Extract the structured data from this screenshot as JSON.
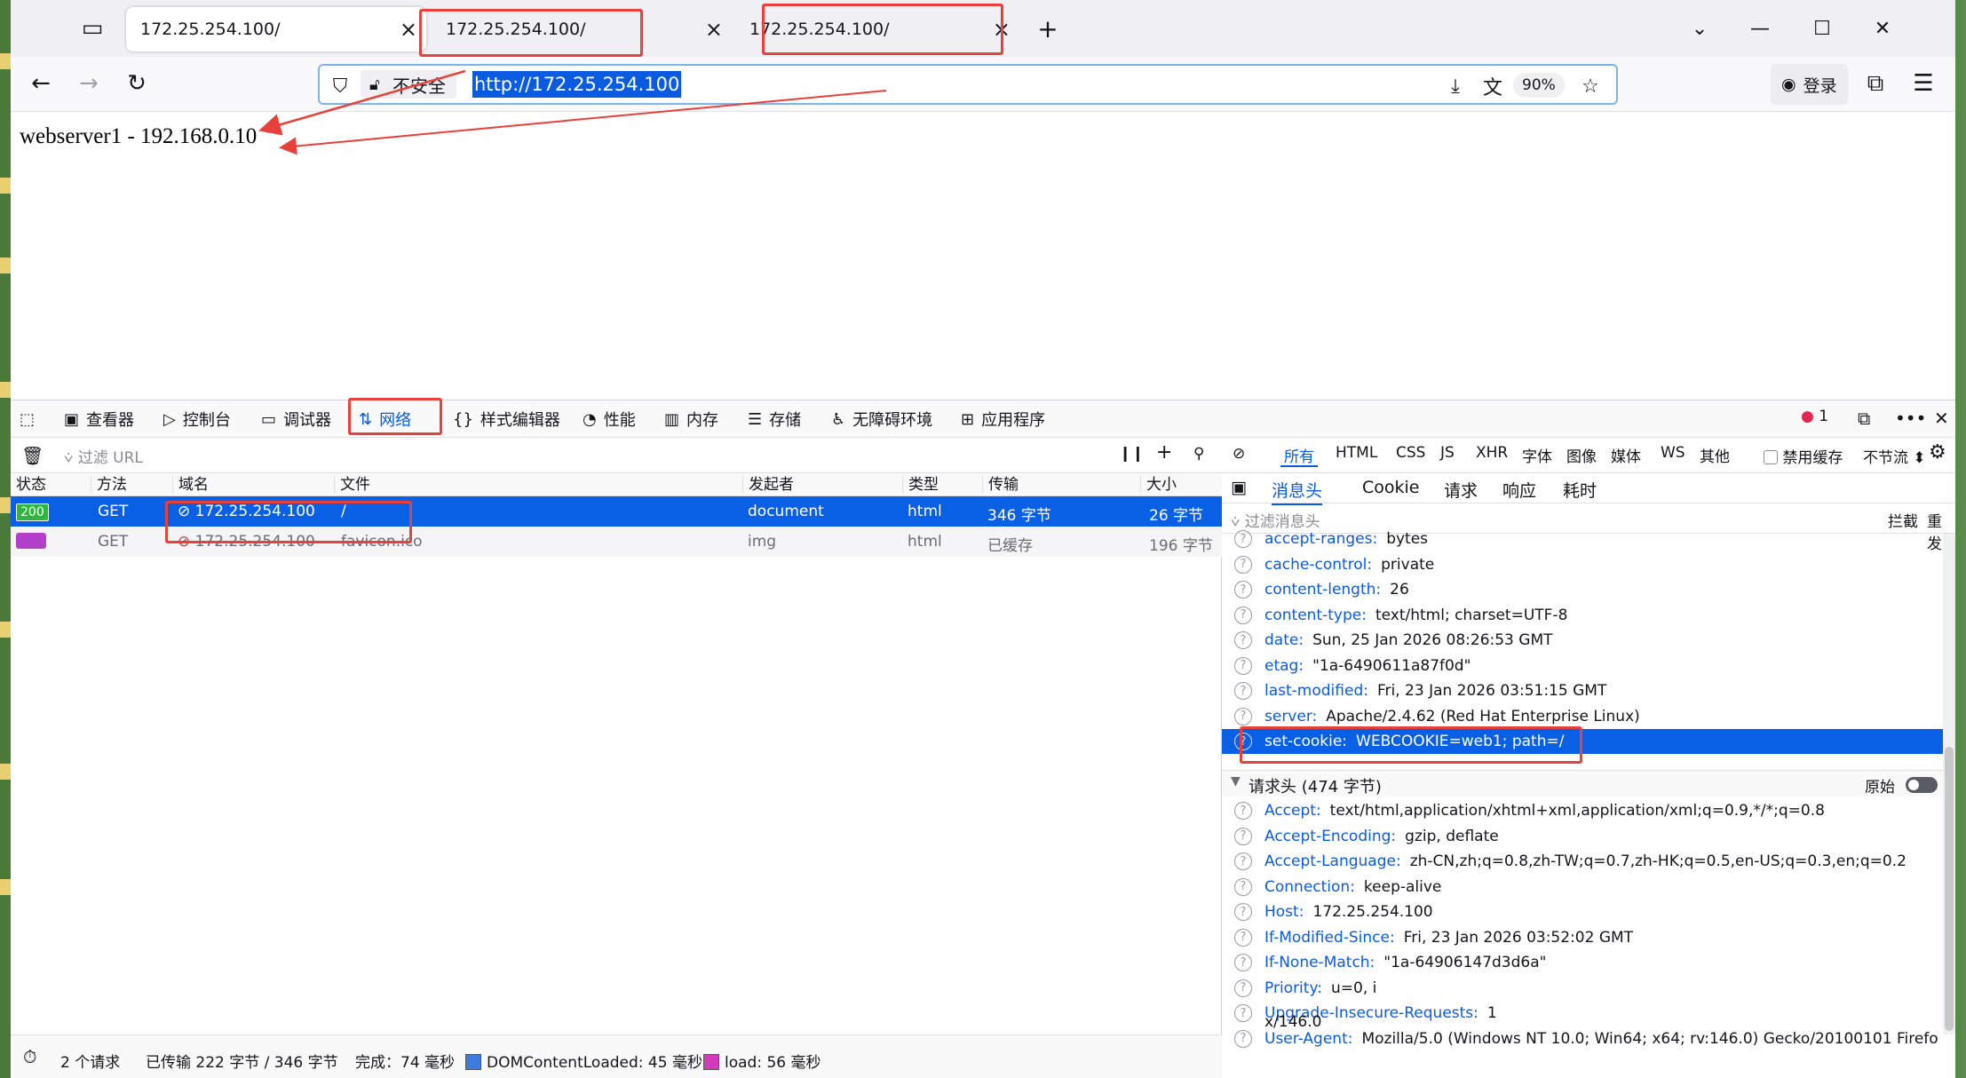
{
  "tabs": [
    {
      "title": "172.25.254.100/",
      "close": "×"
    },
    {
      "title": "172.25.254.100/",
      "close": "×"
    },
    {
      "title": "172.25.254.100/",
      "close": "×"
    }
  ],
  "tabstrip": {
    "new_tab": "+",
    "list_all": "⌄",
    "minimize": "—",
    "maximize": "☐",
    "close": "✕"
  },
  "navbar": {
    "back": "←",
    "forward": "→",
    "reload": "↻",
    "insecure_label": "不安全",
    "url": "http://172.25.254.100",
    "zoom": "90%",
    "login": "登录",
    "extensions": "⧉",
    "menu": "☰"
  },
  "page": {
    "text": "webserver1 - 192.168.0.10"
  },
  "devtools": {
    "tabs": [
      {
        "label": "查看器",
        "icon": "inspector-icon"
      },
      {
        "label": "控制台",
        "icon": "console-icon"
      },
      {
        "label": "调试器",
        "icon": "debugger-icon"
      },
      {
        "label": "网络",
        "icon": "network-icon"
      },
      {
        "label": "样式编辑器",
        "icon": "style-editor-icon"
      },
      {
        "label": "性能",
        "icon": "performance-icon"
      },
      {
        "label": "内存",
        "icon": "memory-icon"
      },
      {
        "label": "存储",
        "icon": "storage-icon"
      },
      {
        "label": "无障碍环境",
        "icon": "accessibility-icon"
      },
      {
        "label": "应用程序",
        "icon": "application-icon"
      }
    ],
    "error_count": "1",
    "filter_placeholder": "过滤 URL",
    "type_filters": [
      "所有",
      "HTML",
      "CSS",
      "JS",
      "XHR",
      "字体",
      "图像",
      "媒体",
      "WS",
      "其他"
    ],
    "disable_cache": "禁用缓存",
    "throttle": "不节流 ⬍",
    "columns": [
      "状态",
      "方法",
      "域名",
      "文件",
      "发起者",
      "类型",
      "传输",
      "大小"
    ],
    "requests": [
      {
        "status": "200",
        "method": "GET",
        "domain": "172.25.254.100",
        "file": "/",
        "initiator": "document",
        "type": "html",
        "transferred": "346 字节",
        "size": "26 字节"
      },
      {
        "status": "",
        "method": "GET",
        "domain": "172.25.254.100",
        "file": "favicon.ico",
        "initiator": "img",
        "type": "html",
        "transferred": "已缓存",
        "size": "196 字节"
      }
    ],
    "detail_tabs": [
      "消息头",
      "Cookie",
      "请求",
      "响应",
      "耗时"
    ],
    "detail_filter_placeholder": "过滤消息头",
    "detail_block": "拦截",
    "detail_resend": "重发",
    "response_headers": [
      {
        "key": "accept-ranges:",
        "value": "bytes"
      },
      {
        "key": "cache-control:",
        "value": "private"
      },
      {
        "key": "content-length:",
        "value": "26"
      },
      {
        "key": "content-type:",
        "value": "text/html; charset=UTF-8"
      },
      {
        "key": "date:",
        "value": "Sun, 25 Jan 2026 08:26:53 GMT"
      },
      {
        "key": "etag:",
        "value": "\"1a-6490611a87f0d\""
      },
      {
        "key": "last-modified:",
        "value": "Fri, 23 Jan 2026 03:51:15 GMT"
      },
      {
        "key": "server:",
        "value": "Apache/2.4.62 (Red Hat Enterprise Linux)"
      },
      {
        "key": "set-cookie:",
        "value": "WEBCOOKIE=web1; path=/"
      }
    ],
    "request_headers_title": "请求头 (474 字节)",
    "raw_label": "原始",
    "request_headers": [
      {
        "key": "Accept:",
        "value": "text/html,application/xhtml+xml,application/xml;q=0.9,*/*;q=0.8"
      },
      {
        "key": "Accept-Encoding:",
        "value": "gzip, deflate"
      },
      {
        "key": "Accept-Language:",
        "value": "zh-CN,zh;q=0.8,zh-TW;q=0.7,zh-HK;q=0.5,en-US;q=0.3,en;q=0.2"
      },
      {
        "key": "Connection:",
        "value": "keep-alive"
      },
      {
        "key": "Host:",
        "value": "172.25.254.100"
      },
      {
        "key": "If-Modified-Since:",
        "value": "Fri, 23 Jan 2026 03:52:02 GMT"
      },
      {
        "key": "If-None-Match:",
        "value": "\"1a-64906147d3d6a\""
      },
      {
        "key": "Priority:",
        "value": "u=0, i"
      },
      {
        "key": "Upgrade-Insecure-Requests:",
        "value": "1"
      },
      {
        "key": "User-Agent:",
        "value": "Mozilla/5.0 (Windows NT 10.0; Win64; x64; rv:146.0) Gecko/20100101 Firefo"
      }
    ],
    "user_agent_wrap": "x/146.0",
    "statusbar": {
      "requests": "2 个请求",
      "transferred": "已传输 222 字节 / 346 字节",
      "finish": "完成：74 毫秒",
      "dcl": "DOMContentLoaded: 45 毫秒",
      "load": "load: 56 毫秒"
    }
  },
  "colors": {
    "accent": "#0a5be0",
    "selection": "#0a60e4",
    "annotation": "#e8403a",
    "status_ok": "#2db83d",
    "dcl": "#3b7ddd",
    "load": "#d23cb8"
  }
}
